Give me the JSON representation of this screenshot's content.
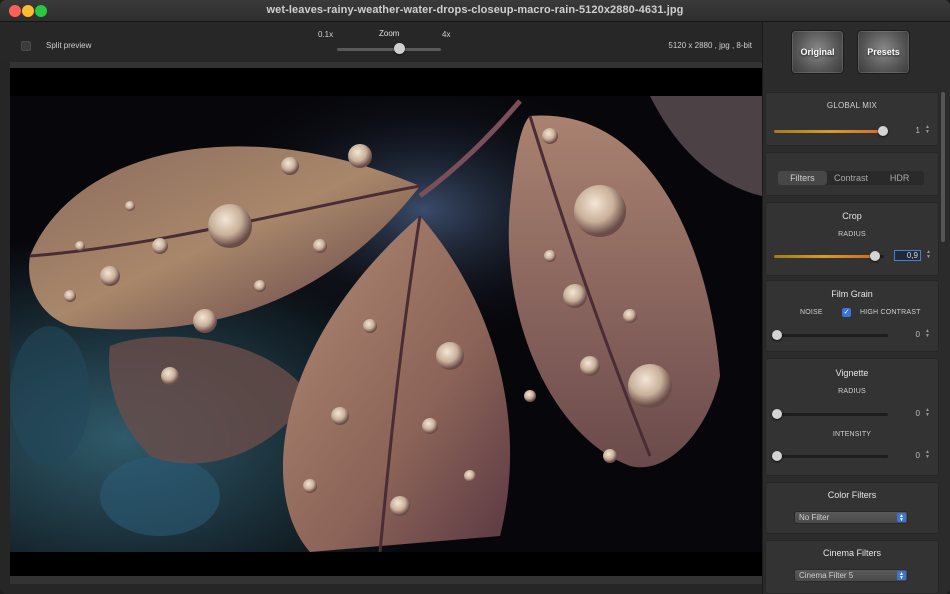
{
  "window": {
    "title": "wet-leaves-rainy-weather-water-drops-closeup-macro-rain-5120x2880-4631.jpg"
  },
  "toolbar": {
    "split_preview_label": "Split preview",
    "zoom_label": "Zoom",
    "zoom_min_label": "0.1x",
    "zoom_max_label": "4x",
    "image_info": "5120 x 2880 , jpg , 8-bit"
  },
  "panel": {
    "original_label": "Original",
    "presets_label": "Presets",
    "global_mix": {
      "title": "GLOBAL MIX",
      "value": "1",
      "level": 1.0
    },
    "tabs": [
      {
        "label": "Filters",
        "active": true
      },
      {
        "label": "Contrast",
        "active": false
      },
      {
        "label": "HDR",
        "active": false
      }
    ],
    "crop": {
      "title": "Crop",
      "radius_label": "RADIUS",
      "radius_value": "0,9",
      "level": 0.9
    },
    "film_grain": {
      "title": "Film Grain",
      "noise_label": "NOISE",
      "high_contrast_label": "HIGH CONTRAST",
      "high_contrast_checked": true,
      "value": "0",
      "level": 0
    },
    "vignette": {
      "title": "Vignette",
      "radius_label": "RADIUS",
      "radius_value": "0",
      "intensity_label": "INTENSITY",
      "intensity_value": "0"
    },
    "color_filters": {
      "title": "Color Filters",
      "selected": "No Filter"
    },
    "cinema_filters": {
      "title": "Cinema Filters",
      "selected": "Cinema Filter 5"
    }
  },
  "colors": {
    "accent": "#3b73d9",
    "slider_fill": "#d89a2a"
  }
}
